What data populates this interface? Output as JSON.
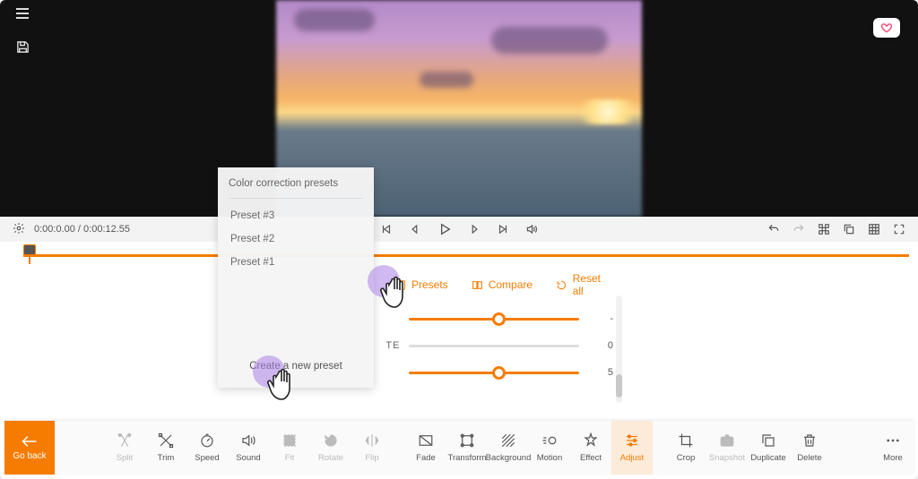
{
  "playbar": {
    "time": "0:00:0.00 / 0:00:12.55"
  },
  "adjust": {
    "presets_label": "Presets",
    "compare_label": "Compare",
    "reset_label": "Reset all",
    "sliders": [
      {
        "label": "",
        "value": "-"
      },
      {
        "label": "TE",
        "value": "0"
      },
      {
        "label": "",
        "value": "5"
      }
    ]
  },
  "presets_popup": {
    "title": "Color correction presets",
    "items": [
      "Preset #3",
      "Preset #2",
      "Preset #1"
    ],
    "create_label": "Create a new preset"
  },
  "bottom": {
    "go_back": "Go back",
    "tools": [
      {
        "id": "split",
        "label": "Split",
        "disabled": true
      },
      {
        "id": "trim",
        "label": "Trim",
        "disabled": false
      },
      {
        "id": "speed",
        "label": "Speed",
        "disabled": false
      },
      {
        "id": "sound",
        "label": "Sound",
        "disabled": false
      },
      {
        "id": "fit",
        "label": "Fit",
        "disabled": true
      },
      {
        "id": "rotate",
        "label": "Rotate",
        "disabled": true
      },
      {
        "id": "flip",
        "label": "Flip",
        "disabled": true
      },
      {
        "id": "fade",
        "label": "Fade",
        "disabled": false
      },
      {
        "id": "transform",
        "label": "Transform",
        "disabled": false
      },
      {
        "id": "background",
        "label": "Background",
        "disabled": false
      },
      {
        "id": "motion",
        "label": "Motion",
        "disabled": false
      },
      {
        "id": "effect",
        "label": "Effect",
        "disabled": false
      },
      {
        "id": "adjust",
        "label": "Adjust",
        "disabled": false,
        "active": true
      },
      {
        "id": "crop",
        "label": "Crop",
        "disabled": false
      },
      {
        "id": "snapshot",
        "label": "Snapshot",
        "disabled": true
      },
      {
        "id": "duplicate",
        "label": "Duplicate",
        "disabled": false
      },
      {
        "id": "delete",
        "label": "Delete",
        "disabled": false
      }
    ],
    "more": "More"
  },
  "colors": {
    "accent": "#f57c00"
  }
}
